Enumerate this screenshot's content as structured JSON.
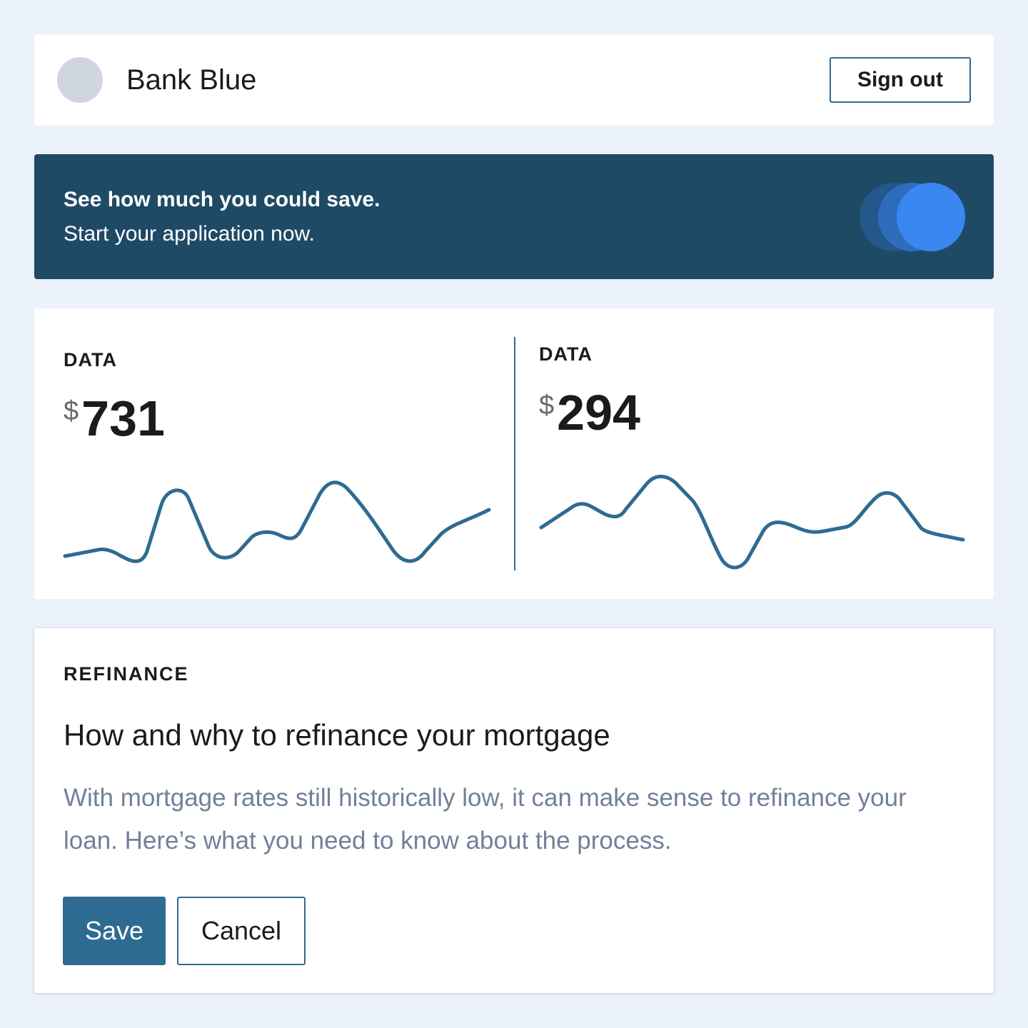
{
  "header": {
    "brand": "Bank Blue",
    "sign_out_label": "Sign out"
  },
  "banner": {
    "title": "See how much you could save.",
    "subtitle": "Start your application now."
  },
  "metrics": [
    {
      "label": "DATA",
      "currency": "$",
      "value": "731"
    },
    {
      "label": "DATA",
      "currency": "$",
      "value": "294"
    }
  ],
  "article": {
    "tag": "REFINANCE",
    "title": "How and why to refinance your mortgage",
    "body": "With mortgage rates still historically low, it can make sense to refinance your loan. Here’s what you need to know about the process.",
    "save_label": "Save",
    "cancel_label": "Cancel"
  },
  "colors": {
    "accent": "#2e6b92",
    "banner": "#1f4a66",
    "background": "#ebf2fa"
  }
}
